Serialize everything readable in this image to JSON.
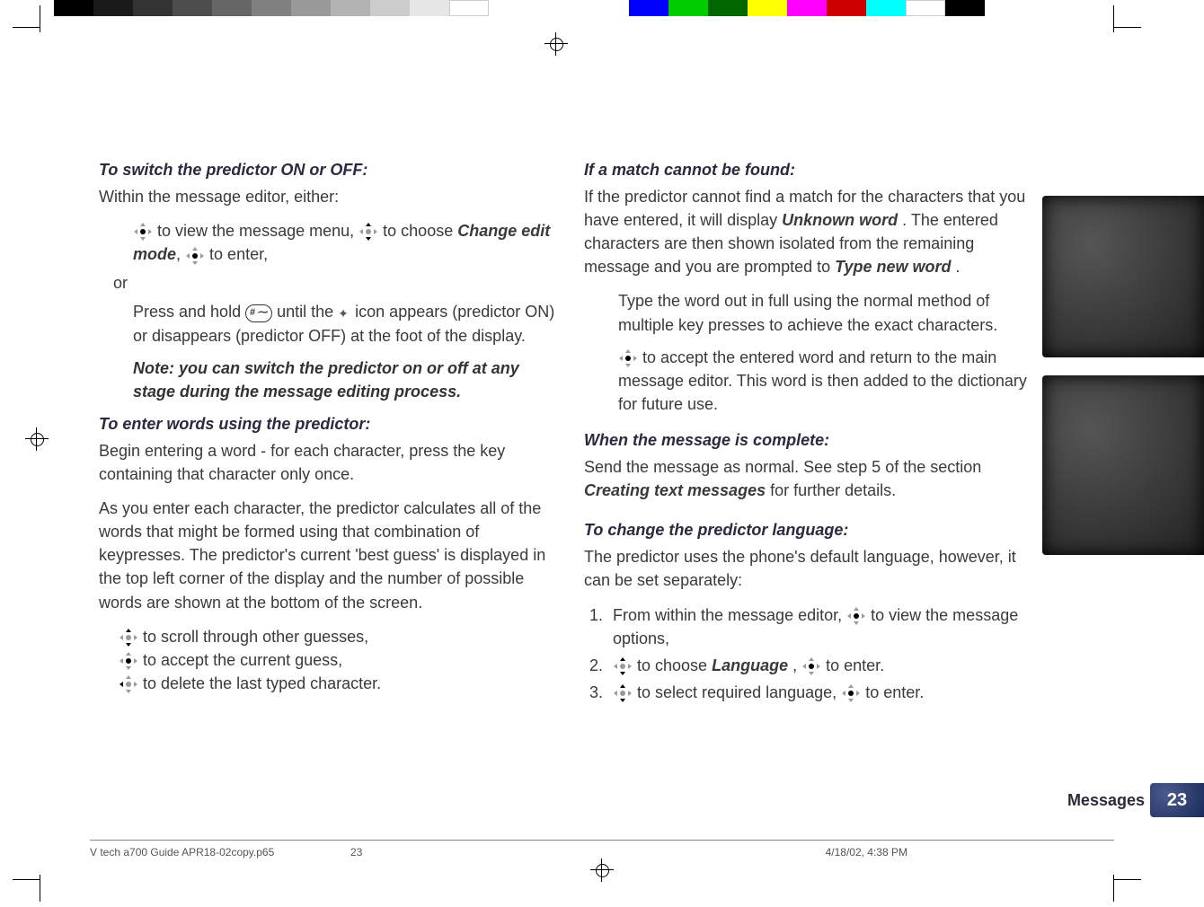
{
  "left": {
    "h1": "To switch the predictor ON or OFF:",
    "p1": "Within the message editor, either:",
    "bullet1a": " to view the message menu, ",
    "bullet1b": " to choose ",
    "bullet1_bold": "Change edit mode",
    "bullet1c": ", ",
    "bullet1d": " to enter,",
    "or": "or",
    "bullet2a": "Press and hold ",
    "bullet2b": " until the ",
    "bullet2c": " icon appears (predictor ON) or disappears (predictor OFF) at the foot of the display.",
    "note": "Note: you can switch the predictor on or off at any stage during the message editing process.",
    "h2": "To enter words using the predictor:",
    "p2": "Begin entering a word - for each character, press the key containing that character only once.",
    "p3": "As you enter each character, the predictor calculates all of the words that might be formed using that combination of keypresses. The predictor's current 'best guess' is displayed in the top left corner of the display and the number of possible words are shown at the bottom of the screen.",
    "b1": " to scroll through other guesses,",
    "b2": " to accept the current guess,",
    "b3": " to delete the last typed character."
  },
  "right": {
    "h1": "If a match cannot be found:",
    "p1a": "If the predictor cannot find a match for the characters that you have entered, it will display ",
    "p1_bold1": "Unknown word",
    "p1b": ". The entered characters are then shown isolated from the remaining message and you are prompted to ",
    "p1_bold2": "Type new word",
    "p1c": ".",
    "bullet1": "Type the word out in full using the normal method of multiple key presses to achieve the exact characters.",
    "bullet2": " to accept the entered word and return to the main message editor. This word is then added to the dictionary for future use.",
    "h2": "When the message is complete:",
    "p2a": "Send the message as normal. See step 5 of the section ",
    "p2_bold": "Creating text messages",
    "p2b": " for further details.",
    "h3": "To change the predictor language:",
    "p3": "The predictor uses the phone's default language, however, it can be set separately:",
    "s1a": "From within the message editor, ",
    "s1b": " to view the message options,",
    "s2a": " to choose ",
    "s2_bold": "Language",
    "s2b": ", ",
    "s2c": " to enter.",
    "s3a": " to select required language, ",
    "s3b": " to enter."
  },
  "footer": {
    "file": "V tech a700 Guide APR18-02copy.p65",
    "page": "23",
    "date": "4/18/02, 4:38 PM"
  },
  "section": "Messages",
  "pagenum": "23",
  "hashkey": "# ⁓"
}
